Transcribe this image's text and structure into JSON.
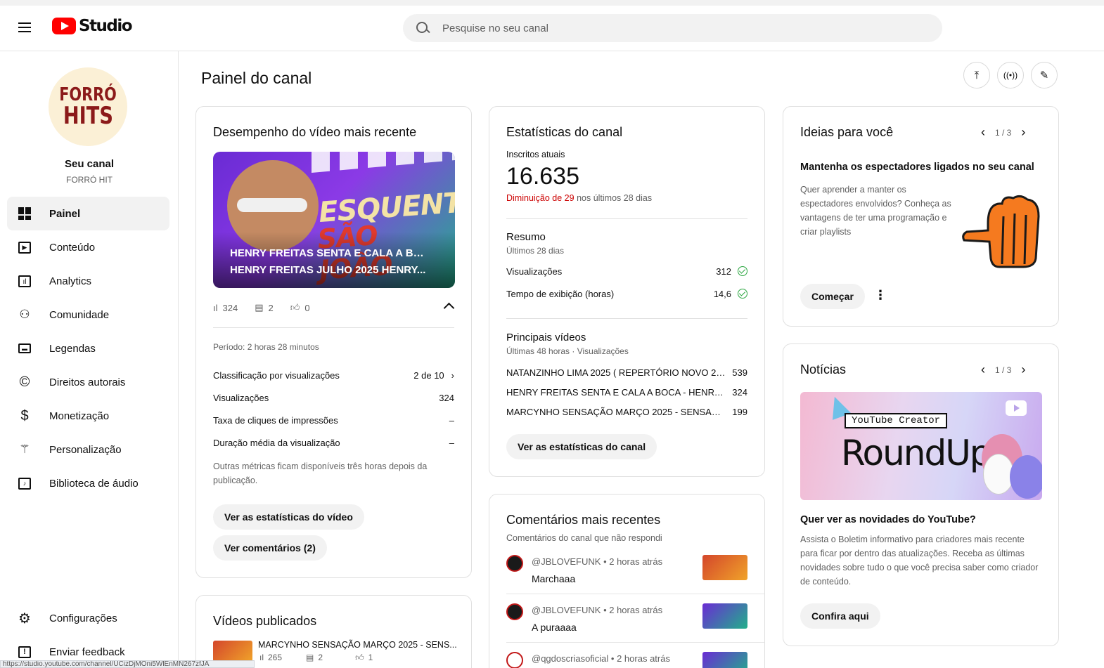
{
  "header": {
    "brand": "Studio",
    "search_placeholder": "Pesquise no seu canal"
  },
  "sidebar": {
    "avatar_line1": "FORRÓ",
    "avatar_line2": "HITS",
    "channel_title": "Seu canal",
    "channel_name": "FORRÓ HIT",
    "items": [
      {
        "label": "Painel",
        "icon": "dashboard-icon",
        "active": true
      },
      {
        "label": "Conteúdo",
        "icon": "content-icon"
      },
      {
        "label": "Analytics",
        "icon": "analytics-icon"
      },
      {
        "label": "Comunidade",
        "icon": "community-icon"
      },
      {
        "label": "Legendas",
        "icon": "subtitles-icon"
      },
      {
        "label": "Direitos autorais",
        "icon": "copyright-icon"
      },
      {
        "label": "Monetização",
        "icon": "dollar-icon"
      },
      {
        "label": "Personalização",
        "icon": "magic-wand-icon"
      },
      {
        "label": "Biblioteca de áudio",
        "icon": "audio-library-icon"
      }
    ],
    "settings_label": "Configurações",
    "feedback_label": "Enviar feedback",
    "status_url": "https://studio.youtube.com/channel/UCizDjMOni5WlEnMN267zfJA"
  },
  "main": {
    "title": "Painel do canal"
  },
  "latest_video": {
    "title": "Desempenho do vídeo mais recente",
    "thumb_text1": "ESQUENTA",
    "thumb_text2": "SÃO JOÃO",
    "caption_line1": "HENRY FREITAS SENTA E CALA A BOCA -",
    "caption_line2": "HENRY FREITAS JULHO 2025 HENRY...",
    "views": "324",
    "comments": "2",
    "likes": "0",
    "period": "Período: 2 horas 28 minutos",
    "rows": [
      {
        "label": "Classificação por visualizações",
        "value": "2 de 10"
      },
      {
        "label": "Visualizações",
        "value": "324"
      },
      {
        "label": "Taxa de cliques de impressões",
        "value": "–"
      },
      {
        "label": "Duração média da visualização",
        "value": "–"
      }
    ],
    "note": "Outras métricas ficam disponíveis três horas depois da publicação.",
    "btn_stats": "Ver as estatísticas do vídeo",
    "btn_comments": "Ver comentários (2)"
  },
  "published": {
    "title": "Vídeos publicados",
    "item_title": "MARCYNHO SENSAÇÃO MARÇO 2025 - SENS...",
    "views": "265",
    "comments": "2",
    "likes": "1"
  },
  "channel_stats": {
    "title": "Estatísticas do canal",
    "subs_label": "Inscritos atuais",
    "subs_value": "16.635",
    "change_red": "Diminuição de 29",
    "change_rest": " nos últimos 28 dias",
    "summary_title": "Resumo",
    "summary_sub": "Últimos 28 dias",
    "summary_rows": [
      {
        "label": "Visualizações",
        "value": "312"
      },
      {
        "label": "Tempo de exibição (horas)",
        "value": "14,6"
      }
    ],
    "top_title": "Principais vídeos",
    "top_sub": "Últimas 48 horas · Visualizações",
    "top_videos": [
      {
        "title": "NATANZINHO LIMA 2025 ( REPERTÓRIO NOVO 2025...",
        "views": "539"
      },
      {
        "title": "HENRY FREITAS SENTA E CALA A BOCA - HENRY FR...",
        "views": "324"
      },
      {
        "title": "MARCYNHO SENSAÇÃO MARÇO 2025 - SENSAÇÃO ...",
        "views": "199"
      }
    ],
    "btn": "Ver as estatísticas do canal"
  },
  "comments": {
    "title": "Comentários mais recentes",
    "sub": "Comentários do canal que não respondi",
    "items": [
      {
        "author": "@JBLOVEFUNK",
        "time": "2 horas atrás",
        "text": "Marchaaa"
      },
      {
        "author": "@JBLOVEFUNK",
        "time": "2 horas atrás",
        "text": "A puraaaa"
      },
      {
        "author": "@qgdoscriasoficial",
        "time": "2 horas atrás",
        "text": ""
      }
    ]
  },
  "ideas": {
    "title": "Ideias para você",
    "pager": "1 / 3",
    "heading": "Mantenha os espectadores ligados no seu canal",
    "body": "Quer aprender a manter os espectadores envolvidos? Conheça as vantagens de ter uma programação e criar playlists",
    "btn": "Começar"
  },
  "news": {
    "title": "Notícias",
    "pager": "1 / 3",
    "img_label": "YouTube Creator",
    "img_title": "RoundUp",
    "heading": "Quer ver as novidades do YouTube?",
    "body": "Assista o Boletim informativo para criadores mais recente para ficar por dentro das atualizações. Receba as últimas novidades sobre tudo o que você precisa saber como criador de conteúdo.",
    "btn": "Confira aqui"
  },
  "colors": {
    "brand_red": "#ff0000",
    "decrease_red": "#cc0000",
    "check_green": "#2ba640",
    "ideas_orange": "#f57a1f"
  }
}
